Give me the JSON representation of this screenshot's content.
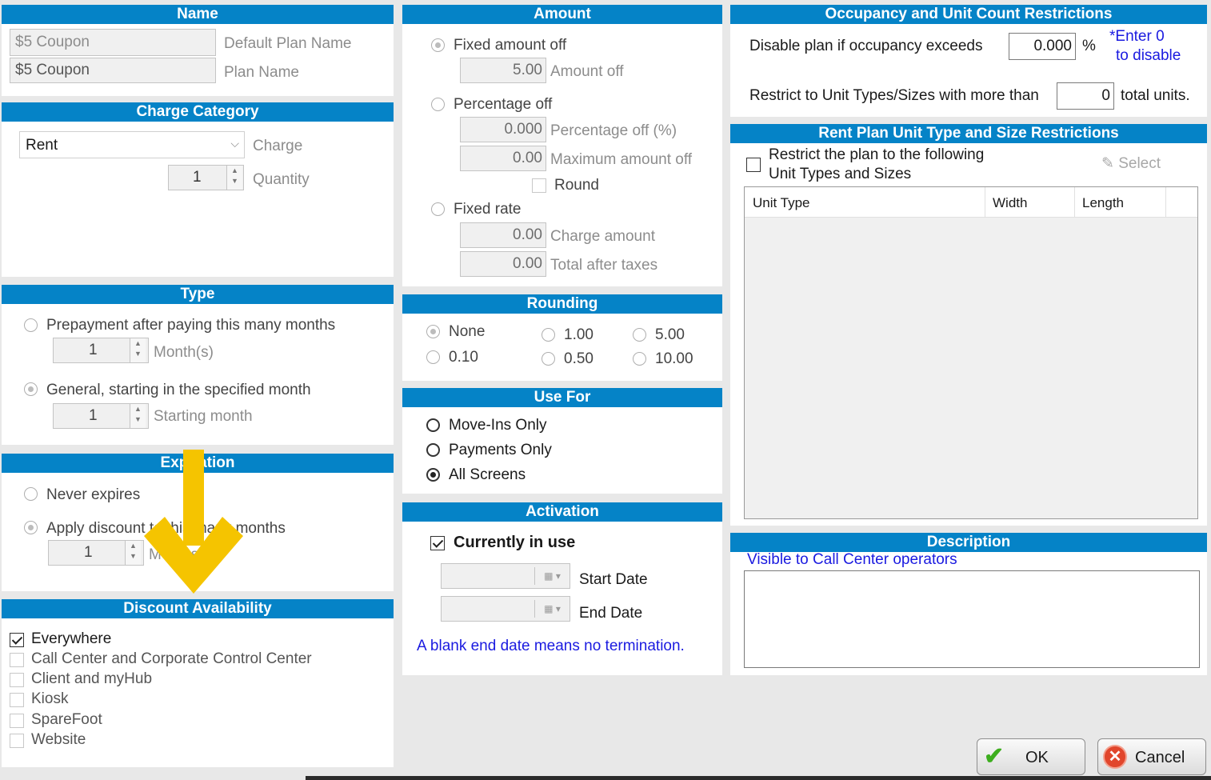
{
  "name": {
    "header": "Name",
    "default_value": "$5 Coupon",
    "default_label": "Default Plan Name",
    "plan_value": "$5 Coupon",
    "plan_label": "Plan Name"
  },
  "charge_category": {
    "header": "Charge Category",
    "charge_value": "Rent",
    "charge_label": "Charge",
    "quantity_value": "1",
    "quantity_label": "Quantity"
  },
  "type": {
    "header": "Type",
    "prepay_label": "Prepayment after paying this many months",
    "months_value": "1",
    "months_label": "Month(s)",
    "general_label": "General, starting in the specified month",
    "start_value": "1",
    "start_label": "Starting month"
  },
  "expiration": {
    "header": "Expiration",
    "never_label": "Never expires",
    "apply_label": "Apply discount to this many months",
    "months_value": "1",
    "months_label": "Months"
  },
  "discount_availability": {
    "header": "Discount Availability",
    "items": [
      "Everywhere",
      "Call Center and Corporate Control Center",
      "Client and myHub",
      "Kiosk",
      "SpareFoot",
      "Website"
    ]
  },
  "amount": {
    "header": "Amount",
    "fixed_off_label": "Fixed amount off",
    "amount_off_value": "5.00",
    "amount_off_label": "Amount off",
    "percent_label": "Percentage off",
    "percent_value": "0.000",
    "percent_field_label": "Percentage off (%)",
    "max_value": "0.00",
    "max_label": "Maximum amount off",
    "round_label": "Round",
    "fixed_rate_label": "Fixed rate",
    "charge_value": "0.00",
    "charge_label": "Charge amount",
    "total_value": "0.00",
    "total_label": "Total after taxes"
  },
  "rounding": {
    "header": "Rounding",
    "options": [
      "None",
      "1.00",
      "5.00",
      "0.10",
      "0.50",
      "10.00"
    ]
  },
  "use_for": {
    "header": "Use For",
    "options": [
      "Move-Ins Only",
      "Payments Only",
      "All Screens"
    ]
  },
  "activation": {
    "header": "Activation",
    "in_use_label": "Currently in use",
    "start_label": "Start Date",
    "end_label": "End Date",
    "note": "A blank end date means no termination."
  },
  "occupancy": {
    "header": "Occupancy and Unit Count Restrictions",
    "disable_label": "Disable plan if occupancy exceeds",
    "occupancy_value": "0.000",
    "percent_sign": "%",
    "hint_line1": "*Enter 0",
    "hint_line2": "to disable",
    "restrict_label": "Restrict to Unit Types/Sizes with more than",
    "units_value": "0",
    "units_suffix": "total units."
  },
  "rent_plan": {
    "header": "Rent Plan Unit Type and Size Restrictions",
    "restrict_line1": "Restrict the plan to the following",
    "restrict_line2": "Unit Types and Sizes",
    "select_label": "Select",
    "columns": [
      "Unit Type",
      "Width",
      "Length"
    ]
  },
  "description": {
    "header": "Description",
    "visible_note": "Visible to Call Center operators"
  },
  "buttons": {
    "ok": "OK",
    "cancel": "Cancel"
  },
  "colors": {
    "header_bg": "#0583c7",
    "arrow": "#f5c400",
    "note_blue": "#1a1ae0"
  }
}
